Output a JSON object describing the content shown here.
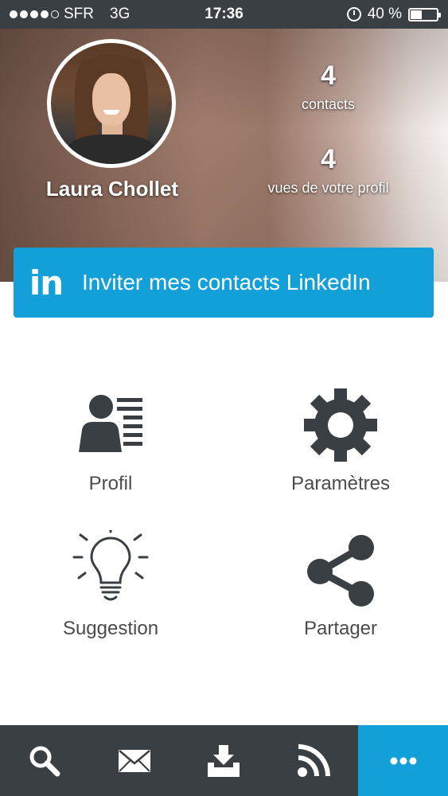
{
  "status_bar": {
    "carrier": "SFR",
    "network": "3G",
    "time": "17:36",
    "battery": "40 %",
    "battery_level": 0.4,
    "signal_bars": 4,
    "signal_max": 5
  },
  "profile": {
    "name": "Laura Chollet",
    "contacts_count": "4",
    "contacts_label": "contacts",
    "views_count": "4",
    "views_label": "vues de votre profil"
  },
  "linkedin_button": {
    "logo": "in",
    "label": "Inviter mes contacts LinkedIn",
    "color": "#13a0d8"
  },
  "menu": [
    {
      "label": "Profil",
      "icon": "profile-card-icon"
    },
    {
      "label": "Paramètres",
      "icon": "gear-icon"
    },
    {
      "label": "Suggestion",
      "icon": "lightbulb-icon"
    },
    {
      "label": "Partager",
      "icon": "share-icon"
    }
  ],
  "tab_bar": {
    "tabs": [
      {
        "icon": "search-icon"
      },
      {
        "icon": "mail-icon"
      },
      {
        "icon": "inbox-download-icon"
      },
      {
        "icon": "rss-icon"
      },
      {
        "icon": "more-icon",
        "active": true
      }
    ],
    "background": "#3a3f44",
    "active_color": "#13a0d8"
  }
}
